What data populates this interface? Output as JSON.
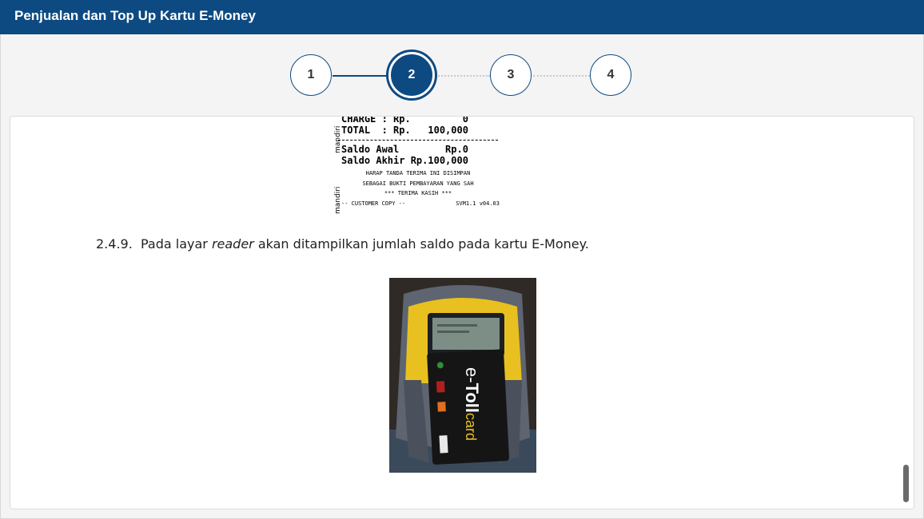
{
  "header": {
    "title": "Penjualan dan Top Up Kartu E-Money"
  },
  "stepper": {
    "steps": [
      {
        "label": "1",
        "state": "done"
      },
      {
        "label": "2",
        "state": "active"
      },
      {
        "label": "3",
        "state": "upcoming"
      },
      {
        "label": "4",
        "state": "upcoming"
      }
    ]
  },
  "receipt": {
    "charge_line": "CHARGE : Rp.         0",
    "total_line": "TOTAL  : Rp.   100,000",
    "saldo_awal_line": "Saldo Awal        Rp.0",
    "saldo_akhir_line": "Saldo Akhir Rp.100,000",
    "note_1": "HARAP TANDA TERIMA INI DISIMPAN",
    "note_2": "SEBAGAI BUKTI PEMBAYARAN YANG SAH",
    "note_3": "*** TERIMA KASIH ***",
    "footer_left": "-- CUSTOMER COPY --",
    "footer_right": "SVM1.1 v04.03",
    "brand_vertical": "mandiri"
  },
  "content": {
    "step_number": "2.4.9.",
    "instruction_before": "Pada layar ",
    "instruction_italic": "reader",
    "instruction_after": " akan ditampilkan jumlah saldo pada kartu E-Money."
  },
  "photo": {
    "card_brand_prefix": "e-",
    "card_brand_main": "Toll",
    "card_brand_suffix": "card"
  },
  "colors": {
    "header_bg": "#0d4a82",
    "accent": "#0d4a82",
    "reader_yellow": "#e8c020"
  }
}
